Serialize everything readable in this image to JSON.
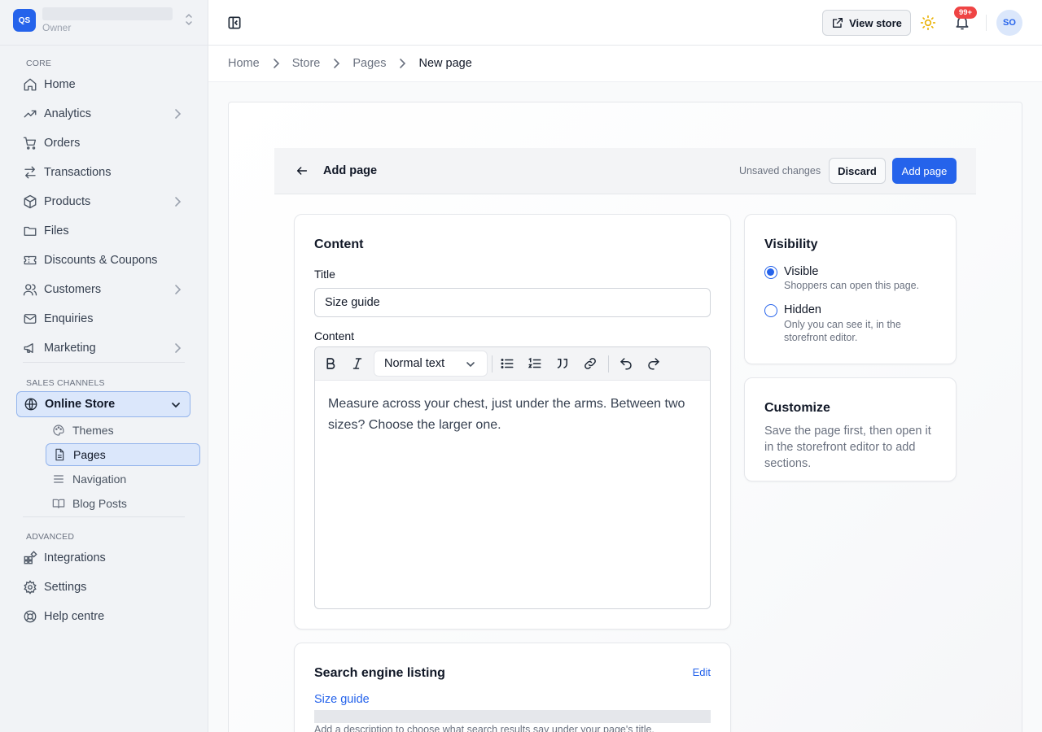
{
  "store": {
    "logo_text": "QS",
    "role": "Owner"
  },
  "sidebar": {
    "sections": {
      "core": "CORE",
      "sales": "SALES CHANNELS",
      "advanced": "ADVANCED"
    },
    "core_items": [
      {
        "label": "Home",
        "icon": "home-icon"
      },
      {
        "label": "Analytics",
        "icon": "trend-icon"
      },
      {
        "label": "Orders",
        "icon": "cart-icon"
      },
      {
        "label": "Transactions",
        "icon": "transfer-icon"
      },
      {
        "label": "Products",
        "icon": "box-icon"
      },
      {
        "label": "Files",
        "icon": "folder-icon"
      },
      {
        "label": "Discounts & Coupons",
        "icon": "ticket-icon"
      },
      {
        "label": "Customers",
        "icon": "users-icon"
      },
      {
        "label": "Enquiries",
        "icon": "mail-icon"
      },
      {
        "label": "Marketing",
        "icon": "megaphone-icon"
      }
    ],
    "channel": {
      "label": "Online Store",
      "icon": "globe-icon"
    },
    "channel_items": [
      {
        "label": "Themes",
        "icon": "palette-icon"
      },
      {
        "label": "Pages",
        "icon": "document-icon"
      },
      {
        "label": "Navigation",
        "icon": "menu-icon"
      },
      {
        "label": "Blog Posts",
        "icon": "book-icon"
      }
    ],
    "advanced_items": [
      {
        "label": "Integrations",
        "icon": "grid-plus-icon"
      },
      {
        "label": "Settings",
        "icon": "gear-icon"
      },
      {
        "label": "Help centre",
        "icon": "lifebuoy-icon"
      }
    ]
  },
  "topbar": {
    "view_store": "View store",
    "notifications": "99+",
    "avatar": "SO"
  },
  "breadcrumb": [
    "Home",
    "Store",
    "Pages",
    "New page"
  ],
  "action_bar": {
    "title": "Add page",
    "status": "Unsaved changes",
    "discard": "Discard",
    "submit": "Add page"
  },
  "content_card": {
    "heading": "Content",
    "title_label": "Title",
    "title_value": "Size guide",
    "content_label": "Content",
    "format": "Normal text",
    "body_text": "Measure across your chest, just under the arms. Between two sizes? Choose the larger one."
  },
  "visibility": {
    "heading": "Visibility",
    "options": [
      {
        "label": "Visible",
        "help": "Shoppers can open this page.",
        "checked": true
      },
      {
        "label": "Hidden",
        "help": "Only you can see it, in the storefront editor.",
        "checked": false
      }
    ]
  },
  "customize": {
    "heading": "Customize",
    "text": "Save the page first, then open it in the storefront editor to add sections."
  },
  "seo": {
    "heading": "Search engine listing",
    "edit": "Edit",
    "link": "Size guide",
    "description": "Add a description to choose what search results say under your page's title."
  },
  "colors": {
    "accent": "#2563eb",
    "badge": "#ef4444",
    "sidebar_bg": "#f1f3f6"
  }
}
